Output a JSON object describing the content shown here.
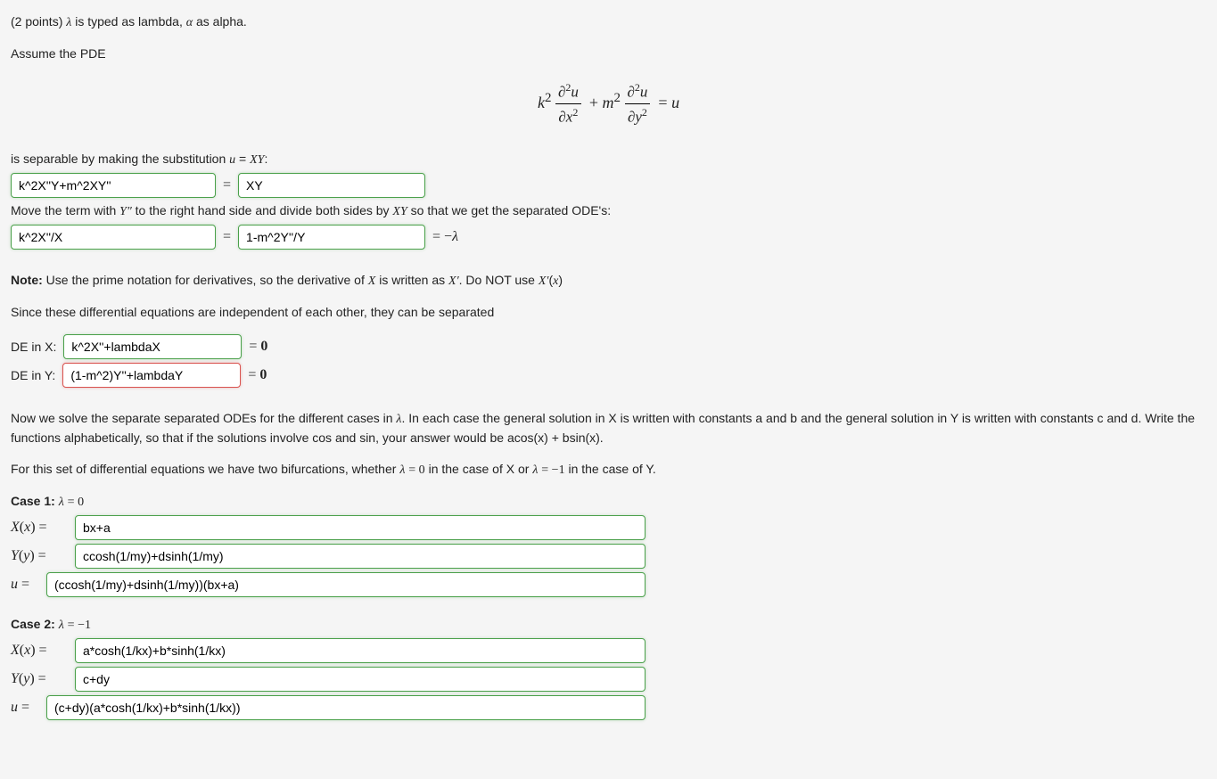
{
  "intro": {
    "points": "(2 points) ",
    "typed_note_prefix": " is typed as lambda, ",
    "typed_note_suffix": " as alpha.",
    "assume": "Assume the PDE"
  },
  "sep": {
    "text1_pre": "is separable by making the substitution ",
    "text1_post": ":",
    "input1": "k^2X''Y+m^2XY''",
    "eq": "=",
    "input2": "XY",
    "move_text_pre": "Move the term with ",
    "move_text_mid": " to the right hand side and divide both sides by ",
    "move_text_post": " so that we get the separated ODE's:",
    "input3": "k^2X''/X",
    "input4": "1-m^2Y''/Y",
    "eq_neglambda": "= −λ"
  },
  "note": {
    "label": "Note:",
    "text_pre": " Use the prime notation for derivatives, so the derivative of ",
    "text_mid": " is written as ",
    "text_post": ". Do NOT use "
  },
  "separated": {
    "line1": "Since these differential equations are independent of each other, they can be separated",
    "deX_label": "DE in X:",
    "deX_value": "k^2X''+lambdaX",
    "deY_label": "DE in Y:",
    "deY_value": "(1-m^2)Y''+lambdaY",
    "eq0": "= 0"
  },
  "solve": {
    "para1_pre": "Now we solve the separate separated ODEs for the different cases in ",
    "para1_post": ". In each case the general solution in X is written with constants a and b and the general solution in Y is written with constants c and d. Write the functions alphabetically, so that if the solutions involve cos and sin, your answer would be acos(x) + bsin(x).",
    "para2_pre": "For this set of differential equations we have two bifurcations, whether ",
    "para2_mid": " in the case of X or ",
    "para2_post": " in the case of Y."
  },
  "case1": {
    "title_pre": "Case 1: ",
    "X_val": "bx+a",
    "Y_val": "ccosh(1/my)+dsinh(1/my)",
    "u_val": "(ccosh(1/my)+dsinh(1/my))(bx+a)"
  },
  "case2": {
    "title_pre": "Case 2: ",
    "X_val": "a*cosh(1/kx)+b*sinh(1/kx)",
    "Y_val": "c+dy",
    "u_val": "(c+dy)(a*cosh(1/kx)+b*sinh(1/kx))"
  },
  "labels": {
    "Xx_eq": "X(x) =",
    "Yy_eq": "Y(y) =",
    "u_eq": "u ="
  }
}
